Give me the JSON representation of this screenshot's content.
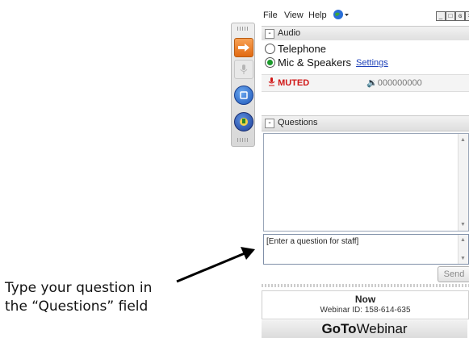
{
  "annotation": {
    "line1": "Type your question in",
    "line2": "the “Questions” field"
  },
  "menubar": {
    "file": "File",
    "view": "View",
    "help": "Help",
    "globe_icon": "globe-icon",
    "window_controls": [
      "minimize-icon",
      "restore-icon",
      "close-icon"
    ]
  },
  "toolbar": {
    "buttons": [
      "arrow-right-icon",
      "microphone-icon",
      "screen-share-icon",
      "globe-hand-icon"
    ]
  },
  "audio": {
    "title": "Audio",
    "telephone": "Telephone",
    "mic_speakers": "Mic & Speakers",
    "settings": "Settings",
    "selected": "Mic & Speakers",
    "muted": "MUTED",
    "volume_icon": "speaker-icon",
    "volume_meter": "000000000"
  },
  "questions": {
    "title": "Questions",
    "input_placeholder": "[Enter a question for staff]",
    "send": "Send"
  },
  "status": {
    "now": "Now",
    "webinar_id": "Webinar ID: 158-614-635"
  },
  "brand": {
    "bold": "GoTo",
    "rest": "Webinar"
  },
  "colors": {
    "muted_red": "#d01818",
    "link_blue": "#1b3fb8",
    "accent_orange": "#e26a12"
  }
}
